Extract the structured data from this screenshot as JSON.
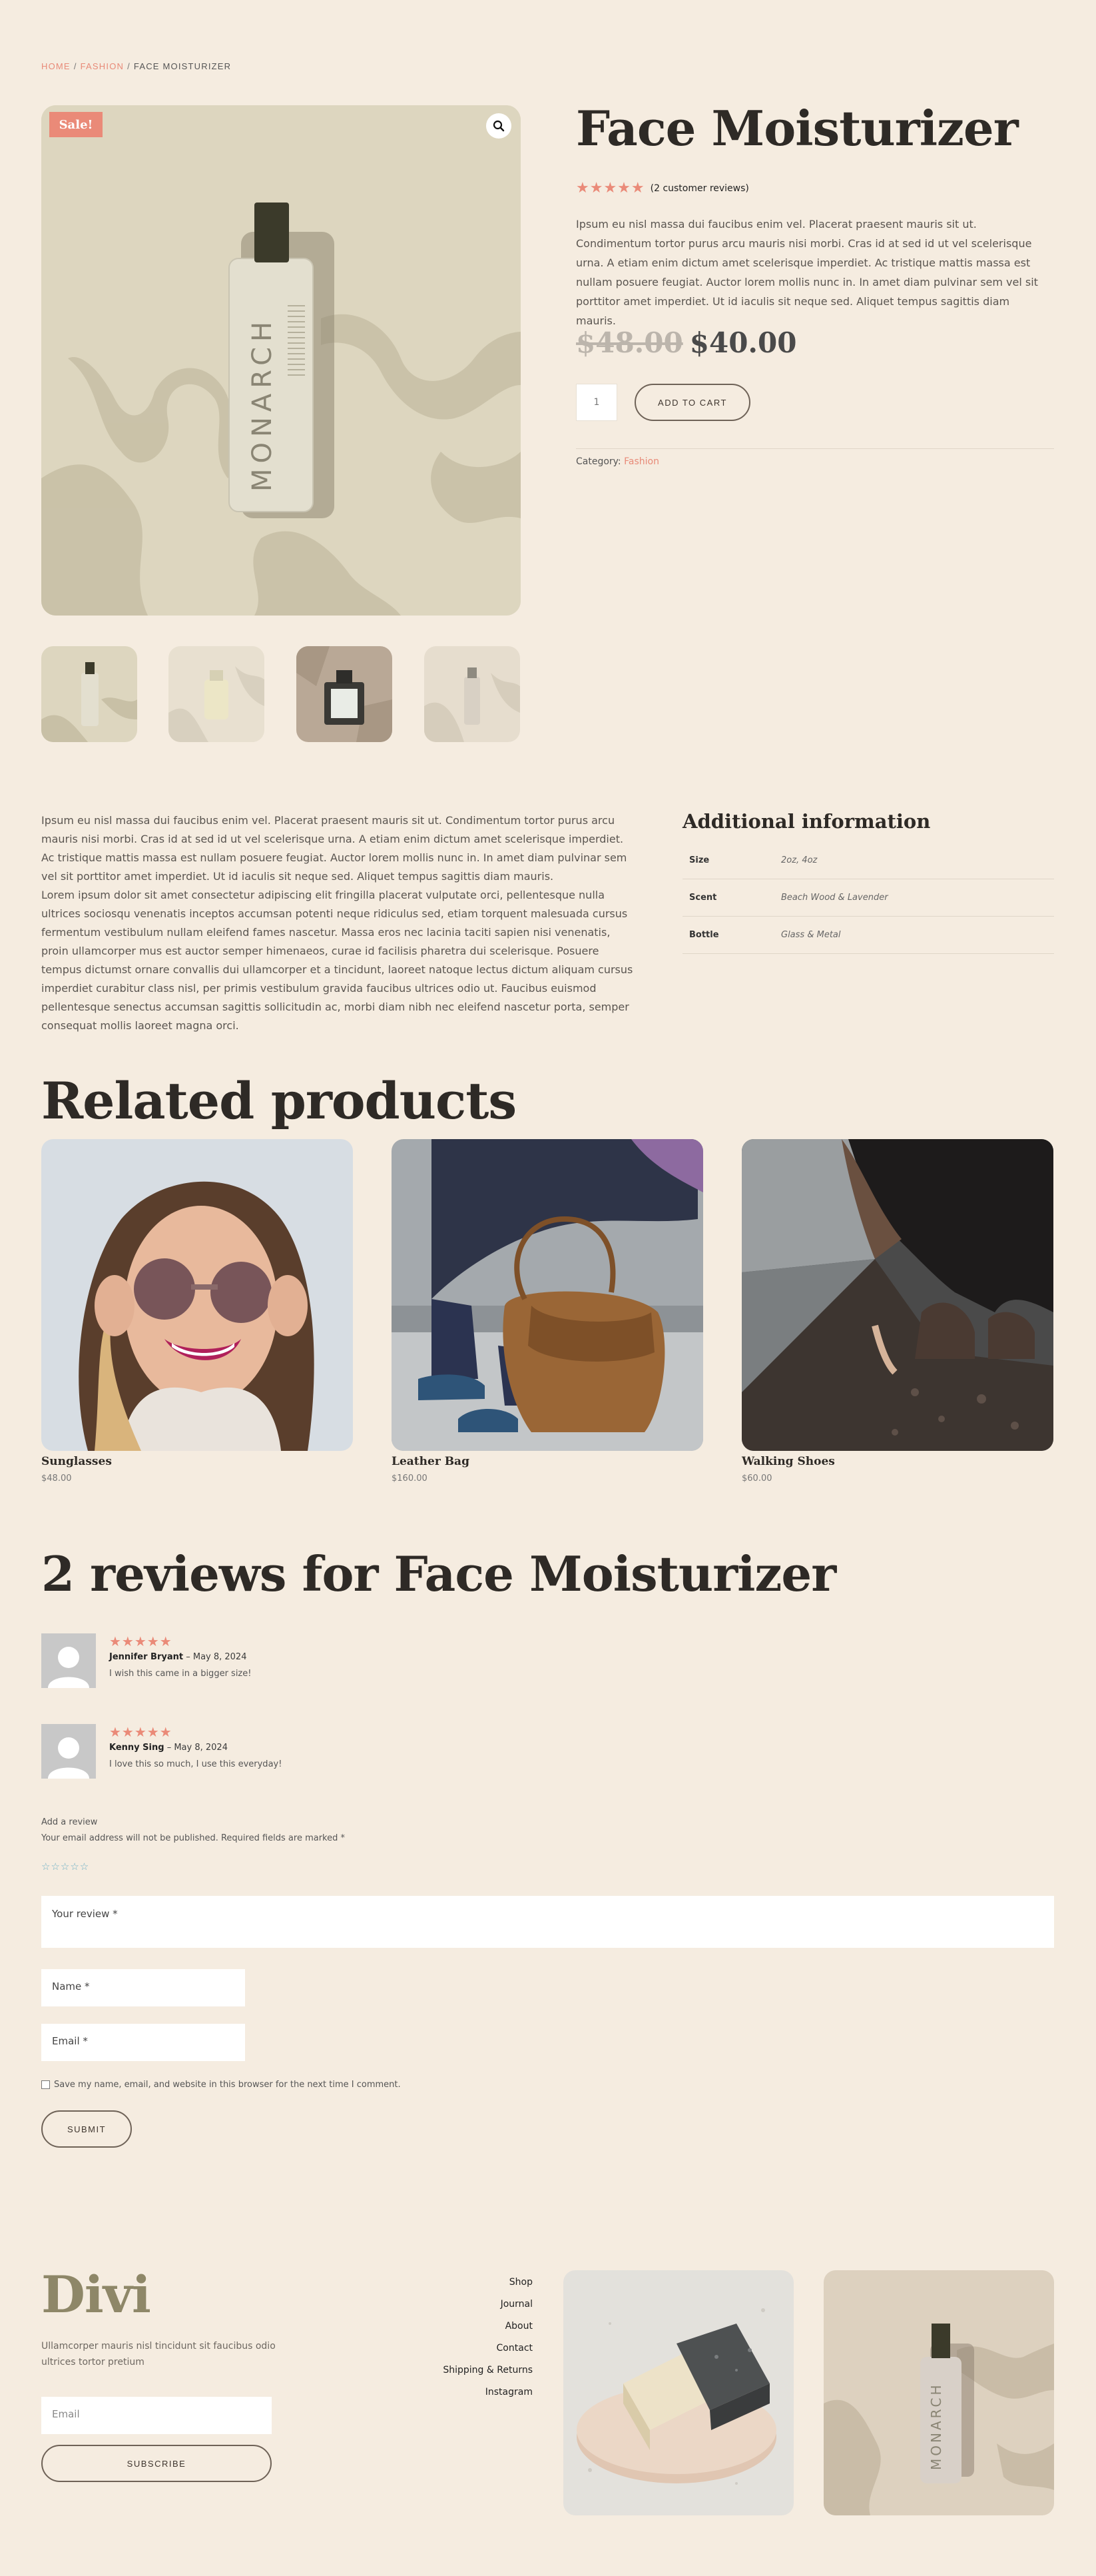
{
  "breadcrumb": {
    "home": "Home",
    "category": "Fashion",
    "current": "Face Moisturizer",
    "separator": "/"
  },
  "product": {
    "sale_badge": "Sale!",
    "zoom_icon": "magnifier-icon",
    "bottle_brand_text": "MONARCH",
    "title": "Face Moisturizer",
    "stars": "★★★★★",
    "rating_count_text": "(2 customer reviews)",
    "short_description": "Ipsum eu nisl massa dui faucibus enim vel. Placerat praesent mauris sit ut. Condimentum tortor purus arcu mauris nisi morbi. Cras id at sed id ut vel scelerisque urna. A etiam enim dictum amet scelerisque imperdiet. Ac tristique mattis massa est nullam posuere feugiat. Auctor lorem mollis nunc in. In amet diam pulvinar sem vel sit porttitor amet imperdiet. Ut id iaculis sit neque sed. Aliquet tempus sagittis diam mauris.",
    "price_old": "$48.00",
    "price_new": "$40.00",
    "quantity": "1",
    "add_to_cart": "Add to cart",
    "category_label": "Category:",
    "category_value": "Fashion"
  },
  "long_description": "Ipsum eu nisl massa dui faucibus enim vel. Placerat praesent mauris sit ut. Condimentum tortor purus arcu mauris nisi morbi. Cras id at sed id ut vel scelerisque urna. A etiam enim dictum amet scelerisque imperdiet. Ac tristique mattis massa est nullam posuere feugiat. Auctor lorem mollis nunc in. In amet diam pulvinar sem vel sit porttitor amet imperdiet. Ut id iaculis sit neque sed. Aliquet tempus sagittis diam mauris.\nLorem ipsum dolor sit amet consectetur adipiscing elit fringilla placerat vulputate orci, pellentesque nulla ultrices sociosqu venenatis inceptos accumsan potenti neque ridiculus sed, etiam torquent malesuada cursus fermentum vestibulum nullam eleifend fames nascetur. Massa eros nec lacinia taciti sapien nisi venenatis, proin ullamcorper mus est auctor semper himenaeos, curae id facilisis pharetra dui scelerisque. Posuere tempus dictumst ornare convallis dui ullamcorper et a tincidunt, laoreet natoque lectus dictum aliquam cursus imperdiet curabitur class nisl, per primis vestibulum gravida faucibus ultrices odio ut. Faucibus euismod pellentesque senectus accumsan sagittis sollicitudin ac, morbi diam nibh nec eleifend nascetur porta, semper consequat mollis laoreet magna orci.",
  "additional_info": {
    "title": "Additional information",
    "rows": [
      {
        "key": "Size",
        "value": "2oz, 4oz"
      },
      {
        "key": "Scent",
        "value": "Beach Wood & Lavender"
      },
      {
        "key": "Bottle",
        "value": "Glass & Metal"
      }
    ]
  },
  "related": {
    "title": "Related products",
    "items": [
      {
        "name": "Sunglasses",
        "price": "$48.00"
      },
      {
        "name": "Leather Bag",
        "price": "$160.00"
      },
      {
        "name": "Walking Shoes",
        "price": "$60.00"
      }
    ]
  },
  "reviews": {
    "title": "2 reviews for Face Moisturizer",
    "items": [
      {
        "stars": "★★★★★",
        "author": "Jennifer Bryant",
        "date": "– May 8, 2024",
        "text": "I wish this came in a bigger size!"
      },
      {
        "stars": "★★★★★",
        "author": "Kenny Sing",
        "date": "– May 8, 2024",
        "text": "I love this so much, I use this everyday!"
      }
    ],
    "form": {
      "add_review": "Add a review",
      "required_note": "Your email address will not be published. Required fields are marked *",
      "star_input": "☆☆☆☆☆",
      "review_placeholder": "Your review *",
      "name_placeholder": "Name *",
      "email_placeholder": "Email *",
      "save_label": "Save my name, email, and website in this browser for the next time I comment.",
      "submit": "Submit"
    }
  },
  "footer": {
    "logo": "Divi",
    "text": "Ullamcorper mauris nisl tincidunt sit faucibus odio ultrices tortor pretium",
    "email_placeholder": "Email",
    "subscribe": "Subscribe",
    "nav": [
      "Shop",
      "Journal",
      "About",
      "Contact",
      "Shipping & Returns",
      "Instagram"
    ]
  },
  "colors": {
    "background": "#f5ece0",
    "accent": "#ea8a78",
    "heading": "#2e2a26",
    "logo": "#8e8768"
  }
}
